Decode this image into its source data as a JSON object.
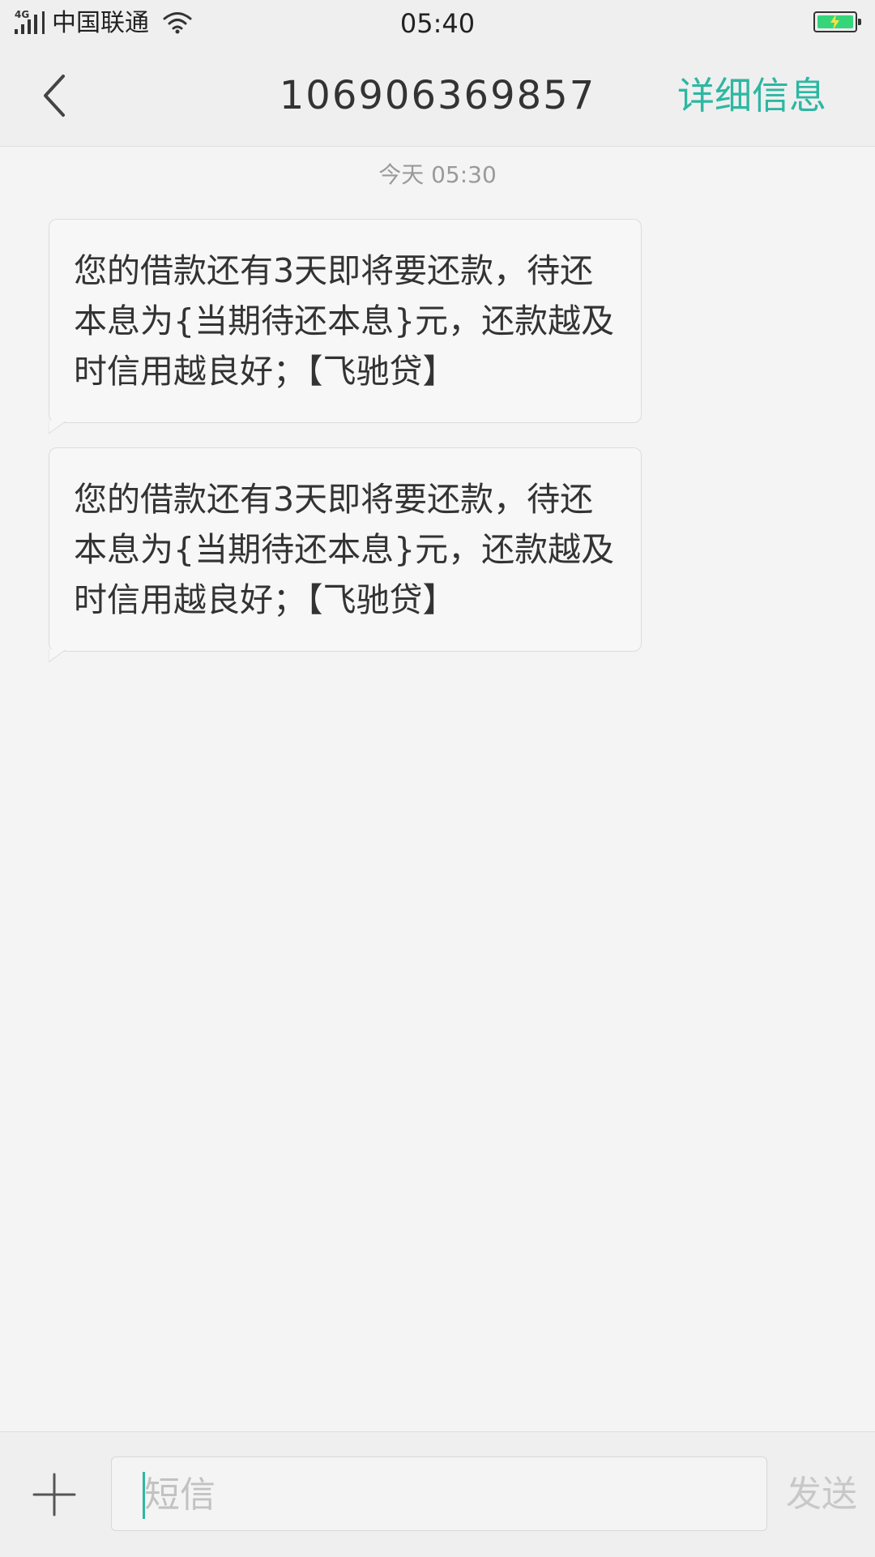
{
  "status_bar": {
    "network": "4G",
    "carrier": "中国联通",
    "time": "05:40",
    "battery_level": 0.9,
    "battery_color": "#35d67a",
    "icons": [
      "signal-icon",
      "wifi-icon",
      "battery-charging-icon"
    ]
  },
  "nav": {
    "title": "106906369857",
    "details_label": "详细信息",
    "accent_color": "#2db7a2",
    "back_icon": "chevron-left-icon"
  },
  "conversation": {
    "timestamp": "今天  05:30",
    "messages": [
      {
        "text": "您的借款还有3天即将要还款，待还本息为{当期待还本息}元，还款越及时信用越良好；【飞驰贷】"
      },
      {
        "text": "您的借款还有3天即将要还款，待还本息为{当期待还本息}元，还款越及时信用越良好；【飞驰贷】"
      }
    ]
  },
  "composer": {
    "placeholder": "短信",
    "send_label": "发送",
    "attach_icon": "plus-icon"
  }
}
